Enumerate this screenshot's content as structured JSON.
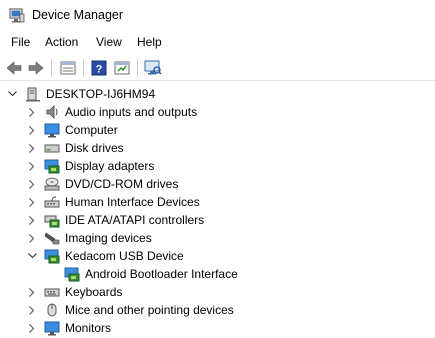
{
  "window": {
    "title": "Device Manager",
    "app_icon": "device-manager-icon"
  },
  "menu": [
    "File",
    "Action",
    "View",
    "Help"
  ],
  "toolbar": {
    "buttons": [
      "back-arrow-icon",
      "forward-arrow-icon",
      "properties-icon",
      "help-icon",
      "update-driver-icon",
      "scan-hardware-icon"
    ]
  },
  "tree": {
    "root": {
      "label": "DESKTOP-IJ6HM94",
      "expanded": true,
      "icon": "computer-tower-icon"
    },
    "categories": [
      {
        "label": "Audio inputs and outputs",
        "icon": "speaker-icon",
        "expanded": false
      },
      {
        "label": "Computer",
        "icon": "monitor-icon",
        "expanded": false
      },
      {
        "label": "Disk drives",
        "icon": "disk-drive-icon",
        "expanded": false
      },
      {
        "label": "Display adapters",
        "icon": "display-adapter-icon",
        "expanded": false
      },
      {
        "label": "DVD/CD-ROM drives",
        "icon": "dvd-drive-icon",
        "expanded": false
      },
      {
        "label": "Human Interface Devices",
        "icon": "hid-icon",
        "expanded": false
      },
      {
        "label": "IDE ATA/ATAPI controllers",
        "icon": "ide-controller-icon",
        "expanded": false
      },
      {
        "label": "Imaging devices",
        "icon": "camera-icon",
        "expanded": false
      },
      {
        "label": "Kedacom USB Device",
        "icon": "usb-device-icon",
        "expanded": true,
        "children": [
          {
            "label": "Android Bootloader Interface",
            "icon": "usb-device-icon"
          }
        ]
      },
      {
        "label": "Keyboards",
        "icon": "keyboard-icon",
        "expanded": false
      },
      {
        "label": "Mice and other pointing devices",
        "icon": "mouse-icon",
        "expanded": false
      },
      {
        "label": "Monitors",
        "icon": "monitor-icon",
        "expanded": false
      }
    ]
  }
}
